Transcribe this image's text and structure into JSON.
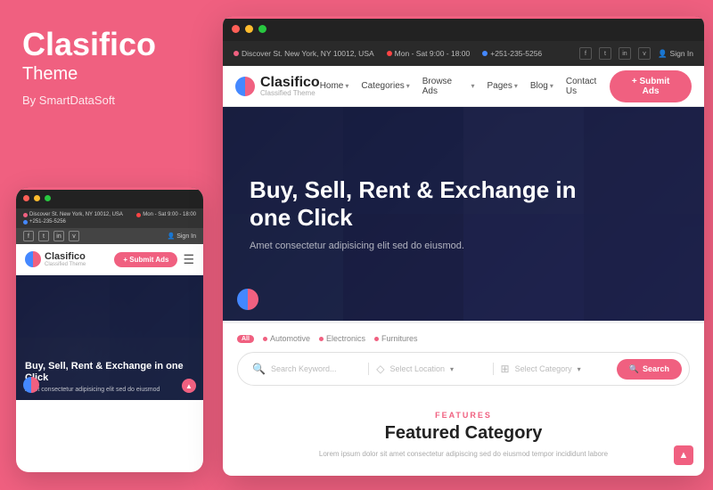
{
  "brand": {
    "title": "Clasifico",
    "subtitle": "Theme",
    "by": "By SmartDataSoft"
  },
  "mobile_preview": {
    "info_items": [
      {
        "icon": "location",
        "text": "Discover St. New York, NY 10012, USA"
      },
      {
        "icon": "clock",
        "text": "Mon - Sat 9:00 - 18:00"
      },
      {
        "icon": "phone",
        "text": "+251-235-5256"
      }
    ],
    "social": [
      "f",
      "t",
      "in",
      "v"
    ],
    "signin": "Sign In",
    "logo_name": "Clasifico",
    "logo_sub": "Classified Theme",
    "submit_btn": "+ Submit Ads",
    "hero_title": "Buy, Sell, Rent & Exchange in one Click",
    "hero_sub": "Amet consectetur adipisicing elit sed do eiusmod"
  },
  "browser": {
    "site_info": {
      "address": "Discover St. New York, NY 10012, USA",
      "hours": "Mon - Sat 9:00 - 18:00",
      "phone": "+251-235-5256"
    },
    "social": [
      "f",
      "t",
      "in",
      "v"
    ],
    "signin": "Sign In",
    "logo": "Clasifico",
    "logo_sub": "Classified Theme",
    "nav_links": [
      {
        "label": "Home",
        "has_caret": true
      },
      {
        "label": "Categories",
        "has_caret": true
      },
      {
        "label": "Browse Ads",
        "has_caret": true
      },
      {
        "label": "Pages",
        "has_caret": true
      },
      {
        "label": "Blog",
        "has_caret": true
      },
      {
        "label": "Contact Us",
        "has_caret": false
      }
    ],
    "submit_btn": "+ Submit Ads",
    "hero_title": "Buy, Sell, Rent & Exchange in one Click",
    "hero_subtitle": "Amet consectetur adipisicing elit sed do eiusmod.",
    "search_tabs": [
      {
        "label": "All",
        "badge": true,
        "active": true
      },
      {
        "label": "Automotive",
        "active": false
      },
      {
        "label": "Electronics",
        "active": false
      },
      {
        "label": "Furnitures",
        "active": false
      }
    ],
    "search_placeholder": "Search Keyword...",
    "location_placeholder": "Select Location",
    "category_placeholder": "Select Category",
    "search_btn": "Search",
    "features_label": "FEATURES",
    "features_title": "Featured Category",
    "features_desc": "Lorem ipsum dolor sit amet consectetur adipiscing sed do eiusmod tempor incididunt labore"
  },
  "colors": {
    "accent": "#f06080",
    "dark": "#2a2a2a",
    "text": "#444"
  }
}
